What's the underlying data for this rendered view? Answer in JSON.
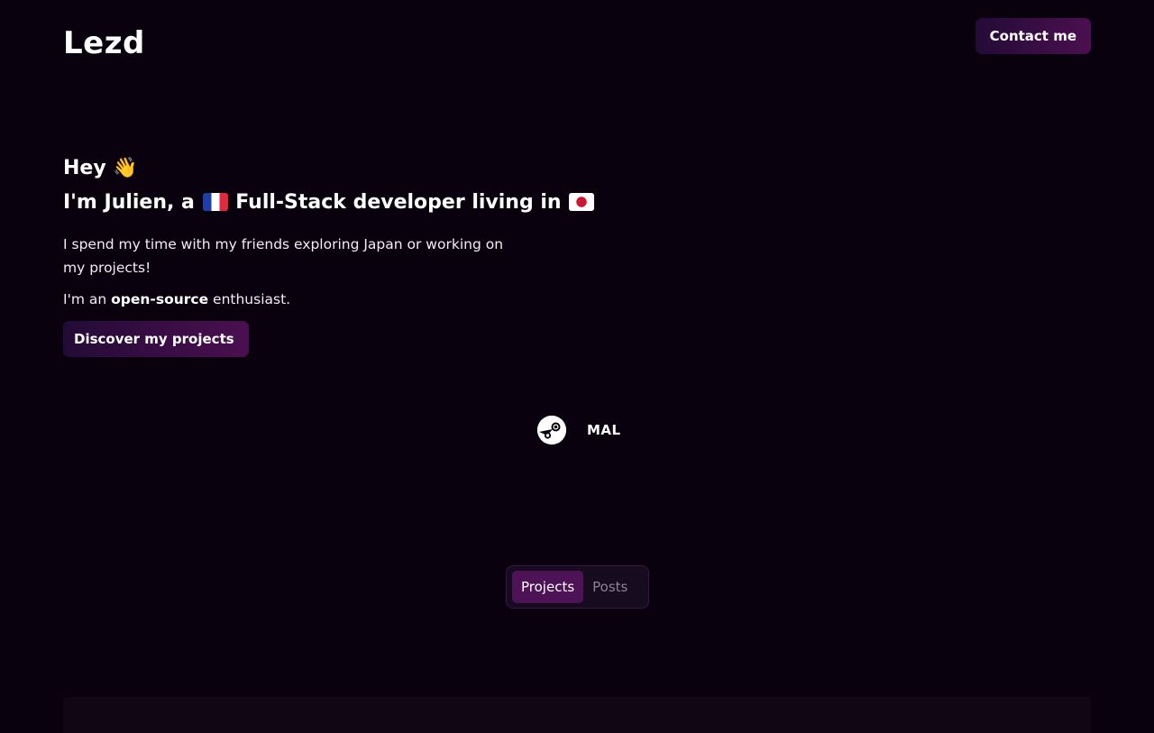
{
  "header": {
    "logo": "Lezd",
    "contact_label": "Contact me"
  },
  "hero": {
    "greeting": "Hey",
    "greeting_emoji": "👋",
    "intro_prefix": "I'm Julien, a",
    "intro_middle": "Full-Stack developer living in",
    "flag_origin": "france-flag-icon",
    "flag_residence": "japan-flag-icon",
    "bio": "I spend my time with my friends exploring Japan or working on my projects!",
    "oss_prefix": "I'm an",
    "oss_bold": "open-source",
    "oss_suffix": "enthusiast.",
    "discover_label": "Discover my projects"
  },
  "socials": {
    "items": [
      {
        "icon": "steam-icon"
      },
      {
        "icon": "mal-icon",
        "label": "MAL"
      }
    ]
  },
  "tabs": {
    "items": [
      {
        "label": "Projects",
        "active": true
      },
      {
        "label": "Posts",
        "active": false
      }
    ]
  },
  "colors": {
    "background": "#09020e",
    "button_gradient_start": "#230b36",
    "button_gradient_end": "#4b0f50",
    "tab_active": "#4e1256",
    "tab_inactive_text": "#8d8493"
  }
}
